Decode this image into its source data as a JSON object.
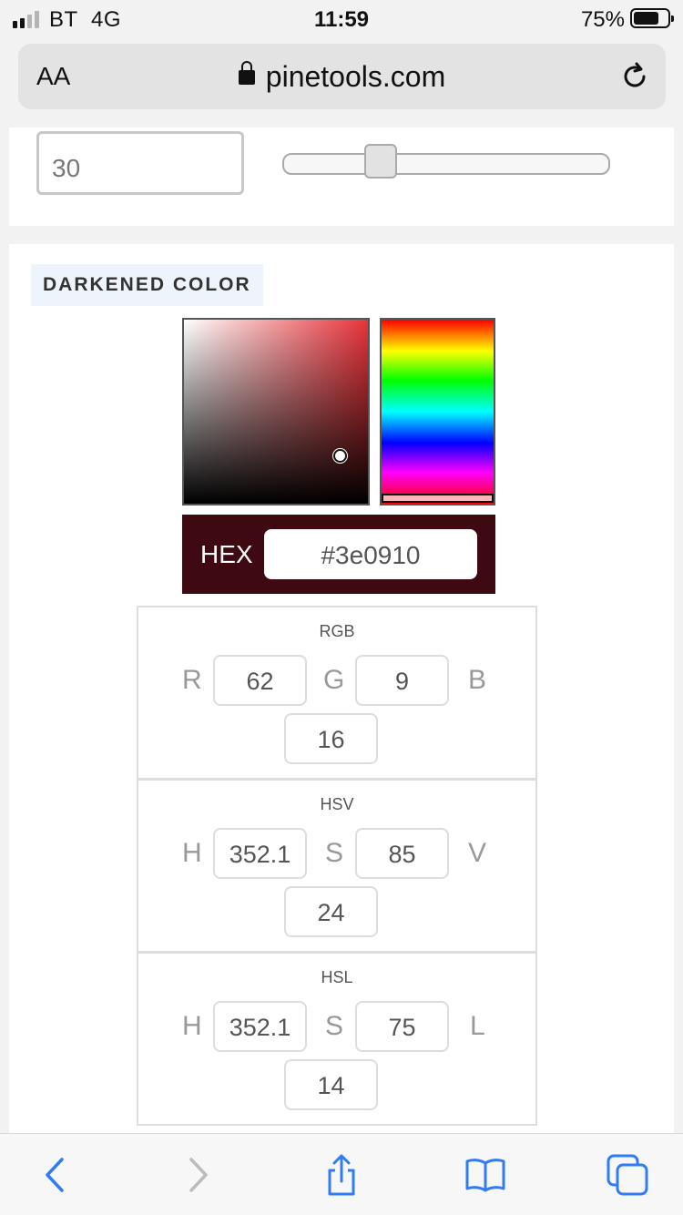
{
  "status_bar": {
    "carrier": "BT",
    "network": "4G",
    "time": "11:59",
    "battery_percent": "75%",
    "battery_level": 0.75
  },
  "browser": {
    "text_size_label": "AA",
    "url": "pinetools.com"
  },
  "controls": {
    "amount_value": "30",
    "amount_slider_fraction": 0.3
  },
  "darkened": {
    "section_label": "DARKENED COLOR",
    "hex_label": "HEX",
    "hex_value": "#3e0910",
    "swatch_color": "#3e0910",
    "rgb": {
      "title": "RGB",
      "l1": "R",
      "v1": "62",
      "l2": "G",
      "v2": "9",
      "l3": "B",
      "v3": "16"
    },
    "hsv": {
      "title": "HSV",
      "l1": "H",
      "v1": "352.1",
      "l2": "S",
      "v2": "85",
      "l3": "V",
      "v3": "24"
    },
    "hsl": {
      "title": "HSL",
      "l1": "H",
      "v1": "352.1",
      "l2": "S",
      "v2": "75",
      "l3": "L",
      "v3": "14"
    }
  },
  "toolbar": {
    "icons": [
      "back-icon",
      "forward-icon",
      "share-icon",
      "bookmarks-icon",
      "tabs-icon"
    ]
  }
}
